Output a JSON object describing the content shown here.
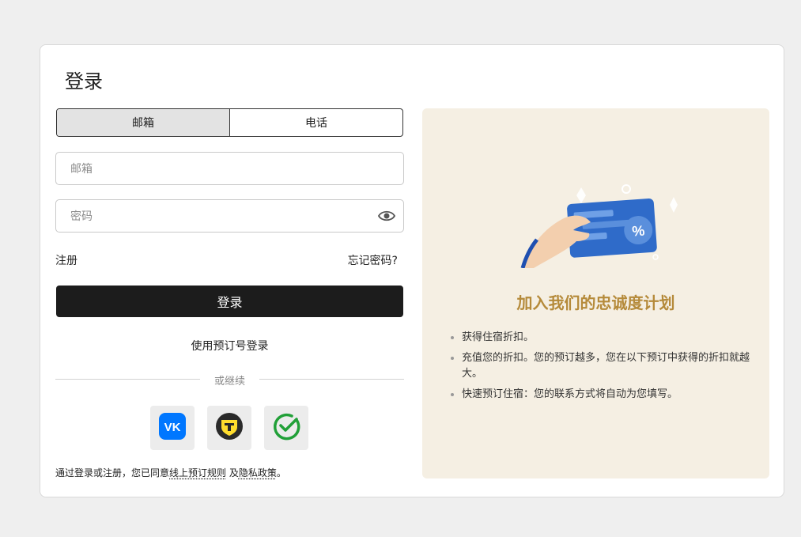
{
  "login": {
    "title": "登录",
    "tabs": [
      {
        "label": "邮箱",
        "active": true
      },
      {
        "label": "电话",
        "active": false
      }
    ],
    "email_placeholder": "邮箱",
    "password_placeholder": "密码",
    "register_label": "注册",
    "forgot_label": "忘记密码?",
    "submit_label": "登录",
    "booking_login_label": "使用预订号登录",
    "divider_text": "或继续",
    "social": [
      {
        "icon": "vk-icon",
        "color": "#0077ff"
      },
      {
        "icon": "tinkoff-icon",
        "color": "#222222"
      },
      {
        "icon": "sber-icon",
        "color": "#21a038"
      }
    ],
    "terms": {
      "prefix": "通过登录或注册，您已同意",
      "rules_link": "线上预订规则",
      "and": " 及",
      "privacy_link": "隐私政策",
      "suffix": "。"
    }
  },
  "promo": {
    "heading": "加入我们的忠诚度计划",
    "benefits": [
      "获得住宿折扣。",
      "充值您的折扣。您的预订越多，您在以下预订中获得的折扣就越大。",
      "快速预订住宿：您的联系方式将自动为您填写。"
    ],
    "accent_color": "#b58a3a",
    "background_color": "#f5efe3",
    "card_badge": "%"
  }
}
